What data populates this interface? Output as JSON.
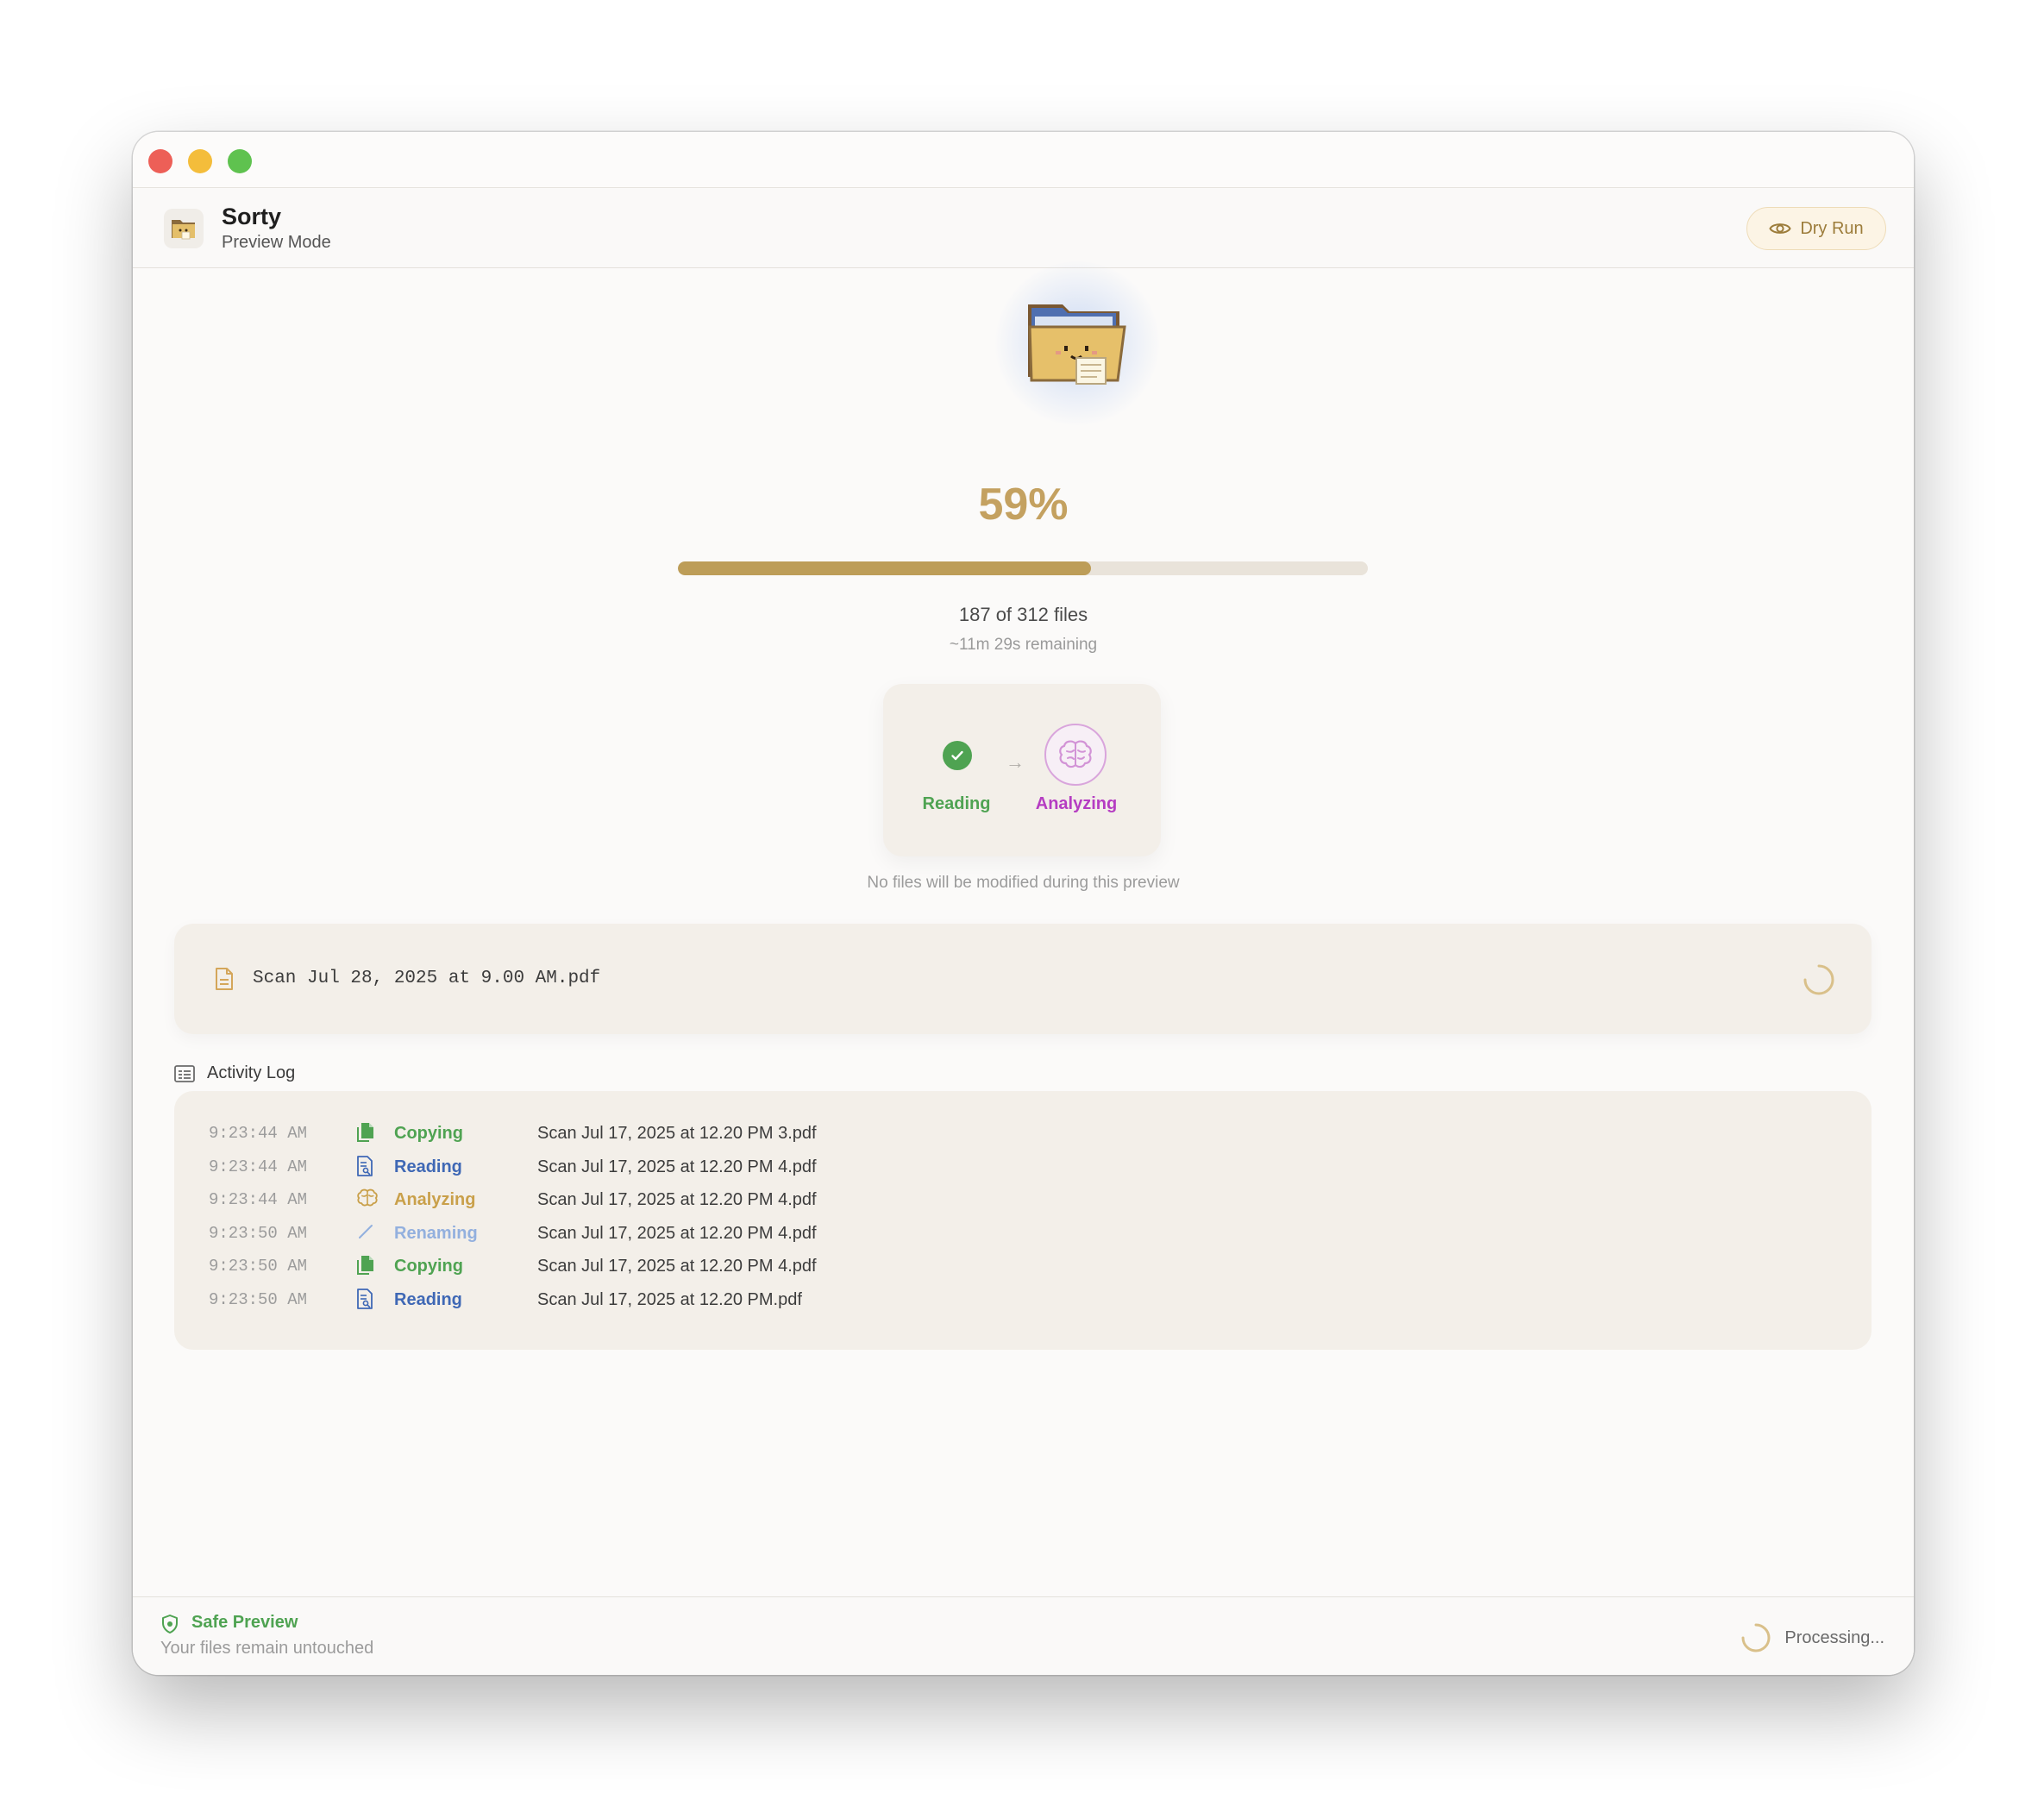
{
  "app": {
    "title": "Sorty",
    "subtitle": "Preview Mode",
    "mode_button": "Dry Run"
  },
  "progress": {
    "percent_label": "59%",
    "fraction": 0.599,
    "files_label": "187 of 312 files",
    "remaining_label": "~11m 29s remaining"
  },
  "stages": {
    "done": {
      "label": "Reading",
      "icon": "check-icon"
    },
    "active": {
      "label": "Analyzing",
      "icon": "brain-icon"
    }
  },
  "notice": "No files will be modified during this preview",
  "current_file": {
    "name": "Scan Jul 28, 2025 at 9.00 AM.pdf",
    "icon": "document-icon"
  },
  "activity_log": {
    "title": "Activity Log",
    "entries": [
      {
        "time": "9:23:44 AM",
        "action": "Copying",
        "file": "Scan Jul 17, 2025 at 12.20 PM 3.pdf",
        "color": "#4fa352",
        "icon": "copy-icon"
      },
      {
        "time": "9:23:44 AM",
        "action": "Reading",
        "file": "Scan Jul 17, 2025 at 12.20 PM 4.pdf",
        "color": "#3f68b5",
        "icon": "read-doc-icon"
      },
      {
        "time": "9:23:44 AM",
        "action": "Analyzing",
        "file": "Scan Jul 17, 2025 at 12.20 PM 4.pdf",
        "color": "#c9a04a",
        "icon": "brain-icon"
      },
      {
        "time": "9:23:50 AM",
        "action": "Renaming",
        "file": "Scan Jul 17, 2025 at 12.20 PM 4.pdf",
        "color": "#93b0de",
        "icon": "pencil-icon"
      },
      {
        "time": "9:23:50 AM",
        "action": "Copying",
        "file": "Scan Jul 17, 2025 at 12.20 PM 4.pdf",
        "color": "#4fa352",
        "icon": "copy-icon"
      },
      {
        "time": "9:23:50 AM",
        "action": "Reading",
        "file": "Scan Jul 17, 2025 at 12.20 PM.pdf",
        "color": "#3f68b5",
        "icon": "read-doc-icon"
      }
    ]
  },
  "footer": {
    "safe_title": "Safe Preview",
    "safe_subtitle": "Your files remain untouched",
    "status": "Processing..."
  },
  "colors": {
    "accent": "#c4a160",
    "progress_fill": "#bd9d58",
    "success": "#4fa352",
    "analyzing": "#b53dc2"
  }
}
